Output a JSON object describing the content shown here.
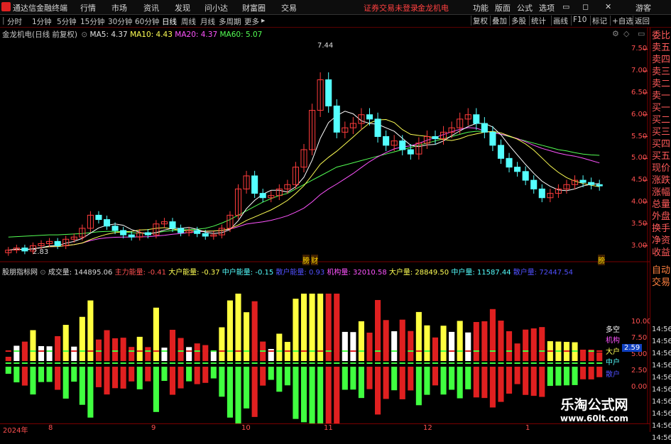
{
  "menu": {
    "app_title": "通达信金融终端",
    "items": [
      "行情",
      "市场",
      "资讯",
      "发现",
      "问小达",
      "财富圈",
      "交易"
    ],
    "notice": "证券交易未登录",
    "stock_name": "金龙机电",
    "right_items": [
      "功能",
      "版面",
      "公式",
      "选项"
    ],
    "user": "游客"
  },
  "toolbar": {
    "periods": [
      "分时",
      "1分钟",
      "5分钟",
      "15分钟",
      "30分钟",
      "60分钟",
      "日线",
      "周线",
      "月线",
      "多周期",
      "更多"
    ],
    "active_period": "日线",
    "tools": [
      "复权",
      "叠加",
      "多股",
      "统计",
      "画线",
      "F10",
      "标记",
      "+自选",
      "返回"
    ]
  },
  "chart_header": {
    "title": "金龙机电(日线 前复权)",
    "ma5": "MA5: 4.37",
    "ma10": "MA10: 4.43",
    "ma20": "MA20: 4.37",
    "ma60": "MA60: 5.07"
  },
  "price_axis": [
    "7.50",
    "7.00",
    "6.50",
    "6.00",
    "5.50",
    "5.00",
    "4.50",
    "4.00",
    "3.50",
    "3.00"
  ],
  "annotations": {
    "high": "7.44",
    "low": "2.83",
    "marker1": "膀",
    "marker2": "财",
    "marker3": "膀"
  },
  "indicator_header": {
    "name": "股朋指标网",
    "volume": "成交量: 144895.06",
    "main_energy": "主力能量: -0.41",
    "big_energy": "大户能量: -0.37",
    "mid_energy": "中户能量: -0.15",
    "retail_energy": "散户能量: 0.93",
    "inst_vol": "机构量: 32010.58",
    "big_vol": "大户量: 28849.50",
    "mid_vol": "中户量: 11587.44",
    "retail_vol": "散户量: 72447.54"
  },
  "indicator_axis": [
    "10.00",
    "7.50",
    "5.00",
    "2.50",
    "0.00"
  ],
  "indicator_labels": {
    "long_short": "多空",
    "inst": "机构",
    "big": "大户",
    "big_value": "2.59",
    "mid": "中户",
    "retail": "散户"
  },
  "right_panel": [
    "委比",
    "卖五",
    "卖四",
    "卖三",
    "卖二",
    "卖一",
    "买一",
    "买二",
    "买三",
    "买四",
    "买五",
    "现价",
    "涨跌",
    "涨幅",
    "总量",
    "外盘",
    "换手",
    "净资",
    "收益",
    "自动",
    "交易"
  ],
  "right_times": [
    "14:56",
    "14:56",
    "14:56",
    "14:56",
    "14:56",
    "14:56",
    "14:56",
    "14:56",
    "14:56",
    "14:56"
  ],
  "date_axis": [
    "2024年",
    "8",
    "9",
    "10",
    "11",
    "12",
    "1"
  ],
  "watermark": {
    "title": "乐淘公式网",
    "url": "www.60lt.com"
  },
  "colors": {
    "up": "#ff3c3c",
    "down": "#54ffff",
    "ma5": "#ffffff",
    "ma10": "#ffff54",
    "ma20": "#ff54ff",
    "ma60": "#54ff54",
    "bg": "#000000",
    "grid": "#7a0000"
  },
  "chart_data": {
    "type": "candlestick",
    "y_range": [
      2.7,
      7.7
    ],
    "closes": [
      2.9,
      2.95,
      2.88,
      3.0,
      3.05,
      3.1,
      3.0,
      3.15,
      3.2,
      3.4,
      3.7,
      3.6,
      3.45,
      3.35,
      3.25,
      3.2,
      3.3,
      3.25,
      3.5,
      3.55,
      3.4,
      3.3,
      3.35,
      3.28,
      3.22,
      3.25,
      3.4,
      3.7,
      4.3,
      4.6,
      4.2,
      4.1,
      4.15,
      4.3,
      4.4,
      4.8,
      5.2,
      6.1,
      6.8,
      6.2,
      5.6,
      5.7,
      5.8,
      6.0,
      5.9,
      5.5,
      5.3,
      5.4,
      5.2,
      5.1,
      5.35,
      5.5,
      5.45,
      5.6,
      5.7,
      5.9,
      6.0,
      5.8,
      5.6,
      5.3,
      5.0,
      4.8,
      4.7,
      4.5,
      4.3,
      4.1,
      4.2,
      4.3,
      4.4,
      4.5,
      4.45,
      4.4,
      4.37
    ],
    "ma60": [
      3.2,
      3.21,
      3.22,
      3.23,
      3.24,
      3.25,
      3.25,
      3.26,
      3.27,
      3.28,
      3.3,
      3.32,
      3.33,
      3.33,
      3.32,
      3.3,
      3.29,
      3.28,
      3.3,
      3.33,
      3.35,
      3.36,
      3.37,
      3.38,
      3.4,
      3.45,
      3.52,
      3.6,
      3.7,
      3.8,
      3.9,
      4.0,
      4.08,
      4.15,
      4.2,
      4.3,
      4.4,
      4.5,
      4.6,
      4.7,
      4.8,
      4.85,
      4.9,
      4.95,
      5.0,
      5.05,
      5.1,
      5.15,
      5.2,
      5.25,
      5.3,
      5.35,
      5.4,
      5.45,
      5.5,
      5.55,
      5.6,
      5.62,
      5.62,
      5.6,
      5.55,
      5.5,
      5.45,
      5.4,
      5.35,
      5.3,
      5.25,
      5.2,
      5.17,
      5.13,
      5.1,
      5.08,
      5.07
    ]
  }
}
